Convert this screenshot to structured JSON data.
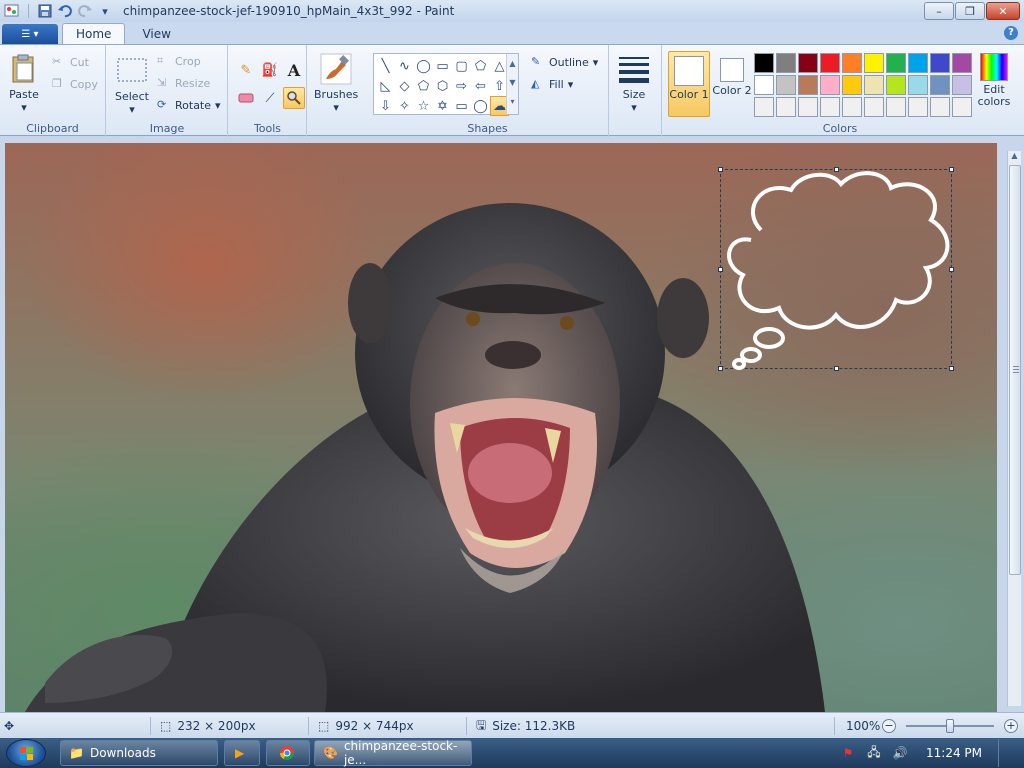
{
  "window": {
    "title": "chimpanzee-stock-jef-190910_hpMain_4x3t_992 - Paint",
    "minimize_glyph": "–",
    "maximize_glyph": "❐",
    "close_glyph": "✕"
  },
  "ribbon": {
    "tabs": [
      {
        "label": "Home"
      },
      {
        "label": "View"
      }
    ],
    "help_glyph": "?",
    "clipboard": {
      "label": "Clipboard",
      "paste": "Paste",
      "cut": "Cut",
      "copy": "Copy"
    },
    "image": {
      "label": "Image",
      "select": "Select",
      "crop": "Crop",
      "resize": "Resize",
      "rotate": "Rotate"
    },
    "tools": {
      "label": "Tools"
    },
    "brushes": {
      "label": "Brushes"
    },
    "shapes": {
      "label": "Shapes",
      "outline": "Outline",
      "fill": "Fill"
    },
    "size": {
      "label": "Size"
    },
    "colors": {
      "label": "Colors",
      "color1": "Color 1",
      "color2": "Color 2",
      "edit": "Edit colors",
      "palette": [
        "#000000",
        "#7f7f7f",
        "#880015",
        "#ed1c24",
        "#ff7f27",
        "#fff200",
        "#22b14c",
        "#00a2e8",
        "#3f48cc",
        "#a349a4",
        "#ffffff",
        "#c3c3c3",
        "#b97a57",
        "#ffaec9",
        "#ffc90e",
        "#efe4b0",
        "#b5e61d",
        "#99d9ea",
        "#7092be",
        "#c8bfe7",
        "#f0f0f0",
        "#f0f0f0",
        "#f0f0f0",
        "#f0f0f0",
        "#f0f0f0",
        "#f0f0f0",
        "#f0f0f0",
        "#f0f0f0",
        "#f0f0f0",
        "#f0f0f0"
      ]
    }
  },
  "status": {
    "selection_size": "232 × 200px",
    "canvas_size": "992 × 744px",
    "file_size": "Size: 112.3KB",
    "zoom": "100%",
    "zoom_out_glyph": "−",
    "zoom_in_glyph": "+"
  },
  "taskbar": {
    "items": [
      {
        "label": "Downloads"
      },
      {
        "label": "chimpanzee-stock-je..."
      }
    ],
    "clock": "11:24 PM"
  }
}
